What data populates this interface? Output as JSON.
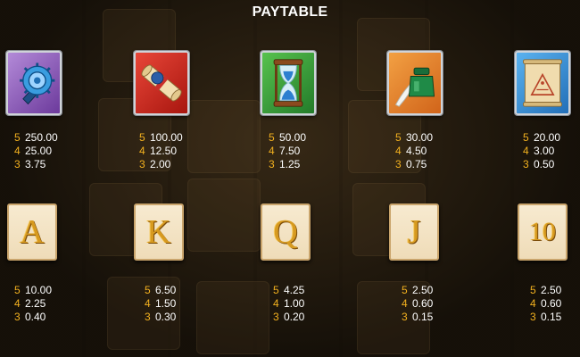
{
  "title": "PAYTABLE",
  "high_symbols": [
    {
      "icon": "gear-seal-stamp-icon",
      "pays": [
        {
          "count": "5",
          "value": "250.00"
        },
        {
          "count": "4",
          "value": "25.00"
        },
        {
          "count": "3",
          "value": "3.75"
        }
      ]
    },
    {
      "icon": "sealed-scroll-icon",
      "pays": [
        {
          "count": "5",
          "value": "100.00"
        },
        {
          "count": "4",
          "value": "12.50"
        },
        {
          "count": "3",
          "value": "2.00"
        }
      ]
    },
    {
      "icon": "hourglass-icon",
      "pays": [
        {
          "count": "5",
          "value": "50.00"
        },
        {
          "count": "4",
          "value": "7.50"
        },
        {
          "count": "3",
          "value": "1.25"
        }
      ]
    },
    {
      "icon": "ink-quill-icon",
      "pays": [
        {
          "count": "5",
          "value": "30.00"
        },
        {
          "count": "4",
          "value": "4.50"
        },
        {
          "count": "3",
          "value": "0.75"
        }
      ]
    },
    {
      "icon": "pyramid-map-icon",
      "pays": [
        {
          "count": "5",
          "value": "20.00"
        },
        {
          "count": "4",
          "value": "3.00"
        },
        {
          "count": "3",
          "value": "0.50"
        }
      ]
    }
  ],
  "low_symbols": [
    {
      "letter": "A",
      "pays": [
        {
          "count": "5",
          "value": "10.00"
        },
        {
          "count": "4",
          "value": "2.25"
        },
        {
          "count": "3",
          "value": "0.40"
        }
      ]
    },
    {
      "letter": "K",
      "pays": [
        {
          "count": "5",
          "value": "6.50"
        },
        {
          "count": "4",
          "value": "1.50"
        },
        {
          "count": "3",
          "value": "0.30"
        }
      ]
    },
    {
      "letter": "Q",
      "pays": [
        {
          "count": "5",
          "value": "4.25"
        },
        {
          "count": "4",
          "value": "1.00"
        },
        {
          "count": "3",
          "value": "0.20"
        }
      ]
    },
    {
      "letter": "J",
      "pays": [
        {
          "count": "5",
          "value": "2.50"
        },
        {
          "count": "4",
          "value": "0.60"
        },
        {
          "count": "3",
          "value": "0.15"
        }
      ]
    },
    {
      "letter": "10",
      "pays": [
        {
          "count": "5",
          "value": "2.50"
        },
        {
          "count": "4",
          "value": "0.60"
        },
        {
          "count": "3",
          "value": "0.15"
        }
      ]
    }
  ],
  "colors": {
    "accent": "#f3b11f",
    "value_text": "#ffffff",
    "card_letter": "#d79a1f"
  }
}
